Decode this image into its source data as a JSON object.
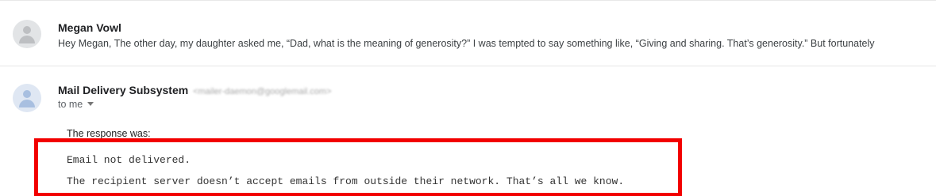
{
  "messages": [
    {
      "sender": "Megan Vowl",
      "snippet": "Hey Megan, The other day, my daughter asked me, “Dad, what is the meaning of generosity?” I was tempted to say something like, “Giving and sharing. That’s generosity.”  But fortunately",
      "avatar_icon": "person-icon"
    },
    {
      "sender": "Mail Delivery Subsystem",
      "email": "<mailer-daemon@googlemail.com>",
      "to_line": "to me",
      "avatar_icon": "person-icon",
      "response_label": "The response was:",
      "body_lines": [
        "Email not delivered.",
        "The recipient server doesn’t accept emails from outside their network. That’s all we know."
      ]
    }
  ],
  "colors": {
    "highlight_border": "#f20000",
    "avatar_grey": "#bdbfc2",
    "avatar_blue": "#a8bfe0"
  }
}
